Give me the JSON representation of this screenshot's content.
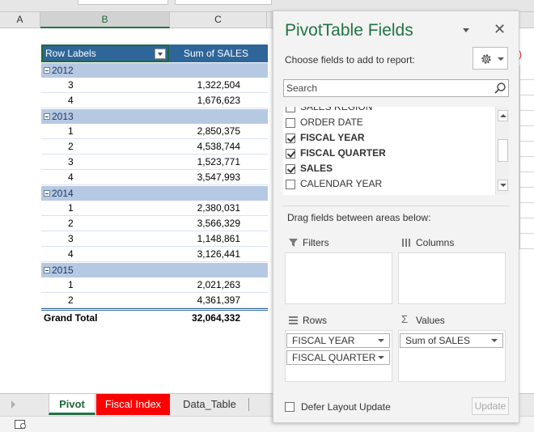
{
  "sheet": {
    "column_headers": [
      "A",
      "B",
      "C"
    ],
    "selected_column": "B"
  },
  "pivot_table": {
    "header": {
      "row_labels": "Row Labels",
      "value_label": "Sum of SALES"
    },
    "years": [
      {
        "year": "2012",
        "rows": [
          {
            "label": "3",
            "value": "1,322,504"
          },
          {
            "label": "4",
            "value": "1,676,623"
          }
        ]
      },
      {
        "year": "2013",
        "rows": [
          {
            "label": "1",
            "value": "2,850,375"
          },
          {
            "label": "2",
            "value": "4,538,744"
          },
          {
            "label": "3",
            "value": "1,523,771"
          },
          {
            "label": "4",
            "value": "3,547,993"
          }
        ]
      },
      {
        "year": "2014",
        "rows": [
          {
            "label": "1",
            "value": "2,380,031"
          },
          {
            "label": "2",
            "value": "3,566,329"
          },
          {
            "label": "3",
            "value": "1,148,861"
          },
          {
            "label": "4",
            "value": "3,126,441"
          }
        ]
      },
      {
        "year": "2015",
        "rows": [
          {
            "label": "1",
            "value": "2,021,263"
          },
          {
            "label": "2",
            "value": "4,361,397"
          }
        ]
      }
    ],
    "grand_total": {
      "label": "Grand Total",
      "value": "32,064,332"
    }
  },
  "right_fragment": ")",
  "sheet_tabs": [
    {
      "label": "Pivot",
      "state": "active"
    },
    {
      "label": "Fiscal Index",
      "state": "red"
    },
    {
      "label": "Data_Table",
      "state": "normal"
    }
  ],
  "pane": {
    "title": "PivotTable Fields",
    "close_glyph": "✕",
    "choose_text": "Choose fields to add to report:",
    "search_placeholder": "Search",
    "fields": [
      {
        "label": "SALES REGION",
        "checked": false
      },
      {
        "label": "ORDER DATE",
        "checked": false
      },
      {
        "label": "FISCAL YEAR",
        "checked": true
      },
      {
        "label": "FISCAL QUARTER",
        "checked": true
      },
      {
        "label": "SALES",
        "checked": true
      },
      {
        "label": "CALENDAR YEAR",
        "checked": false
      }
    ],
    "drag_text": "Drag fields between areas below:",
    "areas": {
      "filters": {
        "label": "Filters",
        "icon": "filter-icon",
        "items": []
      },
      "columns": {
        "label": "Columns",
        "icon": "columns-icon",
        "items": []
      },
      "rows": {
        "label": "Rows",
        "icon": "rows-icon",
        "items": [
          "FISCAL YEAR",
          "FISCAL QUARTER"
        ]
      },
      "values": {
        "label": "Values",
        "icon": "sigma-icon",
        "items": [
          "Sum of SALES"
        ]
      }
    },
    "defer_label": "Defer Layout Update",
    "update_label": "Update"
  },
  "colors": {
    "accent_green": "#217346",
    "pivot_header": "#2f6699",
    "pivot_year_band": "#b6c9e3",
    "red_tab": "#ff0000"
  }
}
